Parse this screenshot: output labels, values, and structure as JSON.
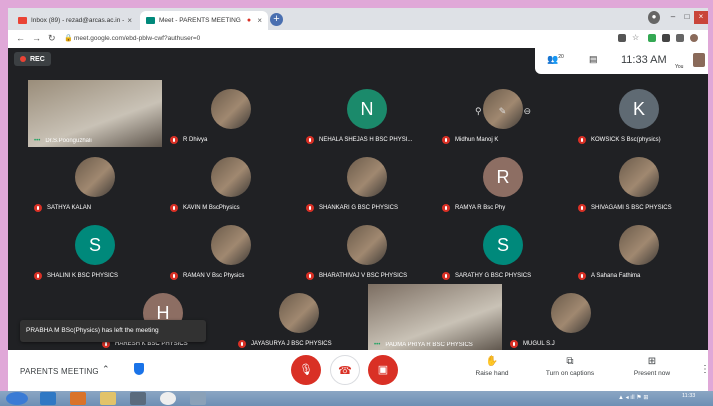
{
  "browser": {
    "tabs": [
      {
        "label": "Inbox (89) - rezad@arcas.ac.in - ",
        "active": false
      },
      {
        "label": "Meet - PARENTS MEETING",
        "active": true
      }
    ],
    "url": "meet.google.com/ebd-pblw-cwf?authuser=0"
  },
  "meet": {
    "rec_label": "REC",
    "participants_badge": "20",
    "clock": "11:33 AM",
    "you_label": "You",
    "toast": "PRABHA M BSc(Physics) has left the meeting",
    "meeting_name": "PARENTS MEETING",
    "raise_hand": "Raise hand",
    "captions": "Turn on captions",
    "present": "Present now"
  },
  "participants": [
    {
      "name": "Dr.S.Poonguzhali",
      "type": "video",
      "color": "#9a8d7a"
    },
    {
      "name": "R Dhivya",
      "type": "photo"
    },
    {
      "name": "NEHALA SHEJAS H BSC PHYSI...",
      "type": "letter",
      "letter": "N",
      "color": "#1b8a6b"
    },
    {
      "name": "Midhun Manoj K",
      "type": "photo"
    },
    {
      "name": "KOWSICK S Bsc(physics)",
      "type": "letter",
      "letter": "K",
      "color": "#5f6a73"
    },
    {
      "name": "SATHYA KALAN",
      "type": "photo"
    },
    {
      "name": "KAVIN M BscPhysics",
      "type": "photo"
    },
    {
      "name": "SHANKARI G BSC PHYSICS",
      "type": "photo"
    },
    {
      "name": "RAMYA R Bsc Phy",
      "type": "letter",
      "letter": "R",
      "color": "#8d6e63"
    },
    {
      "name": "SHIVAGAMI S BSC PHYSICS",
      "type": "photo"
    },
    {
      "name": "SHALINI K BSC PHYSICS",
      "type": "letter",
      "letter": "S",
      "color": "#00897b"
    },
    {
      "name": "RAMAN V Bsc Physics",
      "type": "photo"
    },
    {
      "name": "BHARATHIVAJ V BSC PHYSICS",
      "type": "photo"
    },
    {
      "name": "SARATHY G BSC PHYSICS",
      "type": "letter",
      "letter": "S",
      "color": "#00897b"
    },
    {
      "name": "A Sahana Fathima",
      "type": "photo"
    },
    {
      "name": "HARESH K BSC PHYSICS",
      "type": "letter",
      "letter": "H",
      "color": "#8d6e63"
    },
    {
      "name": "JAYASURYA J BSC PHYSICS",
      "type": "photo"
    },
    {
      "name": "PADMA PRIYA R BSC PHYSICS",
      "type": "video",
      "color": "#7c6e62"
    },
    {
      "name": "MUGUL S.J",
      "type": "photo"
    }
  ],
  "colors": {
    "accent_red": "#d93025",
    "meet_bg": "#202124",
    "speaking_green": "#1ea362"
  }
}
